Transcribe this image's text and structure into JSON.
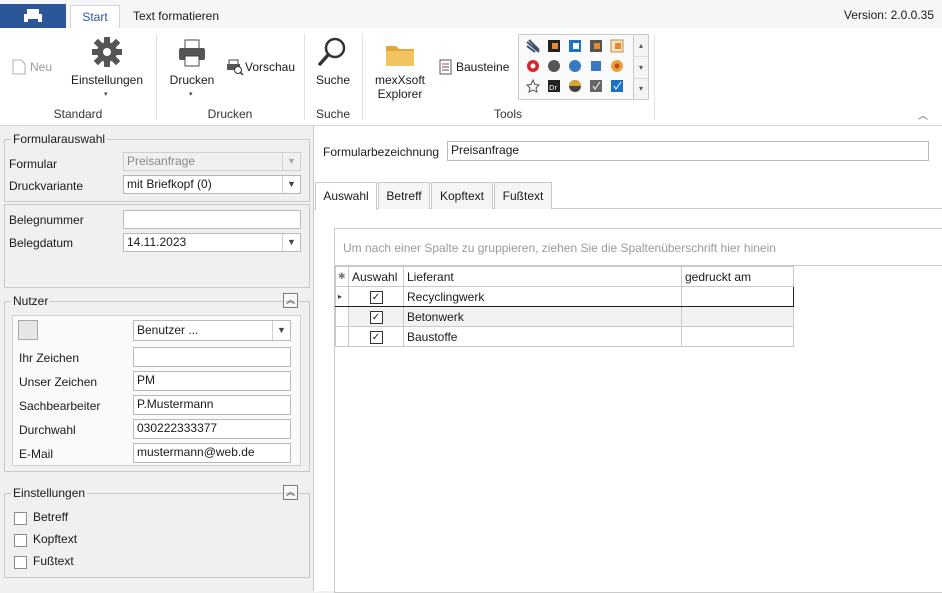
{
  "app": {
    "version": "Version: 2.0.0.35",
    "tabs": [
      {
        "label": "Start",
        "active": true
      },
      {
        "label": "Text formatieren",
        "active": false
      }
    ],
    "accent": "#2b579a"
  },
  "ribbon": {
    "standard": {
      "group": "Standard",
      "neu": "Neu",
      "einstellungen": "Einstellungen"
    },
    "drucken": {
      "group": "Drucken",
      "drucken": "Drucken",
      "vorschau": "Vorschau"
    },
    "suche": {
      "group": "Suche",
      "suche": "Suche"
    },
    "tools": {
      "group": "Tools",
      "explorer": "mexXsoft\nExplorer",
      "bausteine": "Bausteine"
    }
  },
  "formularauswahl": {
    "legend": "Formularauswahl",
    "formular_label": "Formular",
    "formular_value": "Preisanfrage",
    "druckvariante_label": "Druckvariante",
    "druckvariante_value": "mit Briefkopf (0)"
  },
  "beleg": {
    "belegnummer_label": "Belegnummer",
    "belegnummer_value": "",
    "belegdatum_label": "Belegdatum",
    "belegdatum_value": "14.11.2023"
  },
  "nutzer": {
    "legend": "Nutzer",
    "benutzer_select": "Benutzer ...",
    "fields": [
      {
        "label": "Ihr Zeichen",
        "value": ""
      },
      {
        "label": "Unser Zeichen",
        "value": "PM"
      },
      {
        "label": "Sachbearbeiter",
        "value": "P.Mustermann"
      },
      {
        "label": "Durchwahl",
        "value": "030222333377"
      },
      {
        "label": "E-Mail",
        "value": "mustermann@web.de"
      }
    ]
  },
  "einstellungen": {
    "legend": "Einstellungen",
    "options": [
      {
        "label": "Betreff",
        "checked": false
      },
      {
        "label": "Kopftext",
        "checked": false
      },
      {
        "label": "Fußtext",
        "checked": false
      }
    ]
  },
  "main": {
    "formularbezeichnung_label": "Formularbezeichnung",
    "formularbezeichnung_value": "Preisanfrage",
    "tabs": [
      {
        "label": "Auswahl",
        "active": true
      },
      {
        "label": "Betreff",
        "active": false
      },
      {
        "label": "Kopftext",
        "active": false
      },
      {
        "label": "Fußtext",
        "active": false
      }
    ],
    "group_hint": "Um nach einer Spalte zu gruppieren, ziehen Sie die Spaltenüberschrift hier hinein",
    "columns": [
      "Auswahl",
      "Lieferant",
      "gedruckt am"
    ],
    "rows": [
      {
        "auswahl": true,
        "lieferant": "Recyclingwerk",
        "gedruckt_am": "",
        "selected": true
      },
      {
        "auswahl": true,
        "lieferant": "Betonwerk",
        "gedruckt_am": "",
        "selected": false
      },
      {
        "auswahl": true,
        "lieferant": "Baustoffe",
        "gedruckt_am": "",
        "selected": false
      }
    ]
  }
}
